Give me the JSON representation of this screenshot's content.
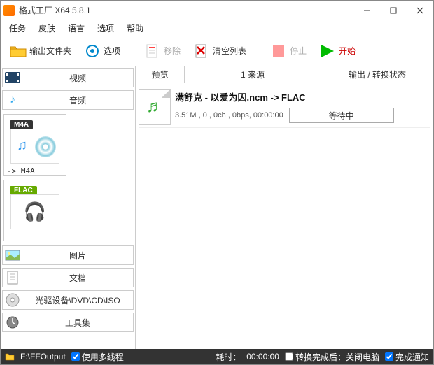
{
  "window": {
    "title": "格式工厂 X64 5.8.1"
  },
  "menus": {
    "task": "任务",
    "skin": "皮肤",
    "lang": "语言",
    "options": "选项",
    "help": "帮助"
  },
  "toolbar": {
    "output_folder": "输出文件夹",
    "options": "选项",
    "remove": "移除",
    "clear": "清空列表",
    "stop": "停止",
    "start": "开始"
  },
  "sidebar": {
    "video": "视频",
    "audio": "音频",
    "image": "图片",
    "document": "文档",
    "disc": "光驱设备\\DVD\\CD\\ISO",
    "toolkit": "工具集"
  },
  "formats": {
    "m4a": {
      "badge": "M4A",
      "sub": "-> M4A"
    },
    "flac": {
      "badge": "FLAC",
      "sub": ""
    }
  },
  "list": {
    "headers": {
      "preview": "预览",
      "source": "1 来源",
      "output": "输出 / 转换状态"
    },
    "items": [
      {
        "title": "满舒克 - 以爱为囚.ncm    -> FLAC",
        "meta": "3.51M , 0 , 0ch , 0bps, 00:00:00",
        "status": "等待中"
      }
    ]
  },
  "statusbar": {
    "output_path": "F:\\FFOutput",
    "multithread": "使用多线程",
    "elapsed_label": "耗时：",
    "elapsed_value": "00:00:00",
    "after": "转换完成后：关闭电脑",
    "notify": "完成通知"
  }
}
